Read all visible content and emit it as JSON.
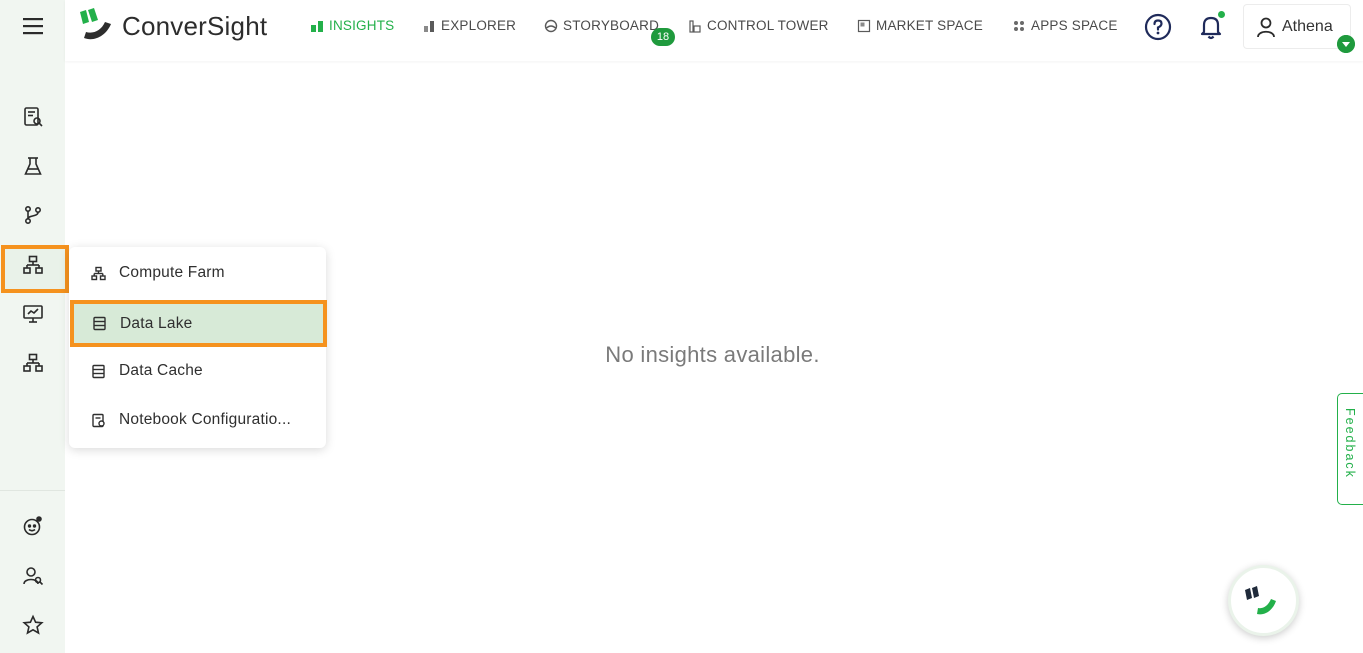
{
  "app": {
    "logo_text": "ConverSight",
    "brand_color": "#23b04a",
    "accent_color": "#f5921e"
  },
  "nav": {
    "items": [
      {
        "label": "INSIGHTS",
        "icon": "bar-chart-icon",
        "active": true
      },
      {
        "label": "EXPLORER",
        "icon": "bar-chart-icon"
      },
      {
        "label": "STORYBOARD",
        "icon": "storyboard-icon"
      },
      {
        "label": "CONTROL TOWER",
        "icon": "tower-icon"
      },
      {
        "label": "MARKET SPACE",
        "icon": "market-icon"
      },
      {
        "label": "APPS SPACE",
        "icon": "apps-grid-icon"
      }
    ],
    "storyboard_badge": "18"
  },
  "user": {
    "name": "Athena"
  },
  "sidebar": {
    "icons": [
      "menu-icon",
      "report-search-icon",
      "flask-icon",
      "branch-icon",
      "sitemap-icon",
      "presentation-icon",
      "sitemap-icon",
      "bot-icon",
      "user-search-icon",
      "star-icon"
    ]
  },
  "popup": {
    "items": [
      {
        "label": "Compute Farm",
        "icon": "sitemap-icon"
      },
      {
        "label": "Data Lake",
        "icon": "table-icon",
        "selected": true
      },
      {
        "label": "Data Cache",
        "icon": "table-icon"
      },
      {
        "label": "Notebook Configuratio...",
        "icon": "notebook-icon"
      }
    ]
  },
  "main": {
    "empty_message": "No insights available."
  },
  "feedback": {
    "label": "Feedback"
  }
}
